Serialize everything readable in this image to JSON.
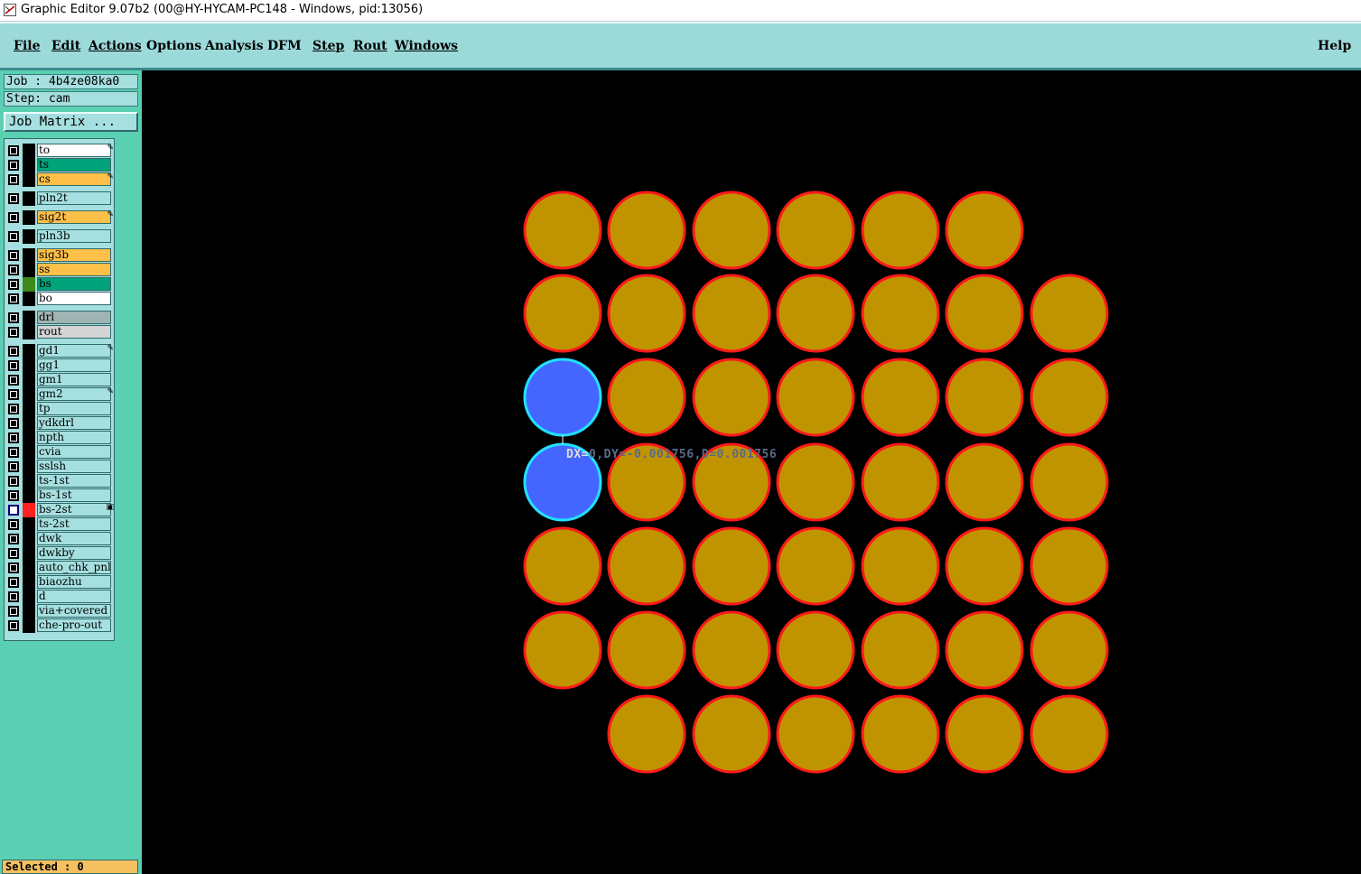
{
  "window": {
    "title": "Graphic Editor 9.07b2 (00@HY-HYCAM-PC148 - Windows, pid:13056)"
  },
  "menu": {
    "items": [
      "File",
      "Edit",
      "Actions",
      "Options",
      "Analysis",
      "DFM",
      "Step",
      "Rout",
      "Windows"
    ],
    "help": "Help"
  },
  "sidebar": {
    "job": "Job : 4b4ze08ka0",
    "step": "Step: cam",
    "job_matrix": "Job Matrix ...",
    "layers": [
      {
        "name": "to",
        "color": "#ffffff",
        "mark": "edit"
      },
      {
        "name": "ts",
        "color": "#00a37a",
        "mark": ""
      },
      {
        "name": "cs",
        "color": "#ffc04a",
        "mark": "edit"
      },
      {
        "name": "pln2t",
        "color": "#a6dfdf",
        "mark": ""
      },
      {
        "name": "sig2t",
        "color": "#ffc04a",
        "mark": "edit"
      },
      {
        "name": "pln3b",
        "color": "#a6dfdf",
        "mark": ""
      },
      {
        "name": "sig3b",
        "color": "#ffc04a",
        "mark": ""
      },
      {
        "name": "ss",
        "color": "#ffc04a",
        "mark": ""
      },
      {
        "name": "bs",
        "color": "#00a37a",
        "mark": ""
      },
      {
        "name": "bo",
        "color": "#ffffff",
        "mark": ""
      },
      {
        "name": "drl",
        "color": "#a0b4b4",
        "mark": ""
      },
      {
        "name": "rout",
        "color": "#d4d4d4",
        "mark": ""
      },
      {
        "name": "gd1",
        "color": "#a6dfdf",
        "mark": "edit"
      },
      {
        "name": "gg1",
        "color": "#a6dfdf",
        "mark": ""
      },
      {
        "name": "gm1",
        "color": "#a6dfdf",
        "mark": ""
      },
      {
        "name": "gm2",
        "color": "#a6dfdf",
        "mark": "edit"
      },
      {
        "name": "tp",
        "color": "#a6dfdf",
        "mark": ""
      },
      {
        "name": "ydkdrl",
        "color": "#a6dfdf",
        "mark": ""
      },
      {
        "name": "npth",
        "color": "#a6dfdf",
        "mark": ""
      },
      {
        "name": "cvia",
        "color": "#a6dfdf",
        "mark": ""
      },
      {
        "name": "sslsh",
        "color": "#a6dfdf",
        "mark": ""
      },
      {
        "name": "ts-1st",
        "color": "#a6dfdf",
        "mark": ""
      },
      {
        "name": "bs-1st",
        "color": "#a6dfdf",
        "mark": ""
      },
      {
        "name": "bs-2st",
        "color": "#a6dfdf",
        "mark": "work"
      },
      {
        "name": "ts-2st",
        "color": "#a6dfdf",
        "mark": ""
      },
      {
        "name": "dwk",
        "color": "#a6dfdf",
        "mark": ""
      },
      {
        "name": "dwkby",
        "color": "#a6dfdf",
        "mark": ""
      },
      {
        "name": "auto_chk_pnl",
        "color": "#a6dfdf",
        "mark": ""
      },
      {
        "name": "biaozhu",
        "color": "#a6dfdf",
        "mark": ""
      },
      {
        "name": "d",
        "color": "#a6dfdf",
        "mark": ""
      },
      {
        "name": "via+covered",
        "color": "#a6dfdf",
        "mark": ""
      },
      {
        "name": "che-pro-out",
        "color": "#a6dfdf",
        "mark": ""
      }
    ],
    "selected": "Selected : 0"
  },
  "canvas": {
    "measure": {
      "dx_label": "DX=",
      "dx_rest": "0,DY=-0.001756,D=0.001756"
    },
    "pad_color": "#c09400",
    "pad_outline": "#ff1a1a",
    "highlight_color": "#4466ff",
    "highlight_outline": "#22e0ff"
  }
}
